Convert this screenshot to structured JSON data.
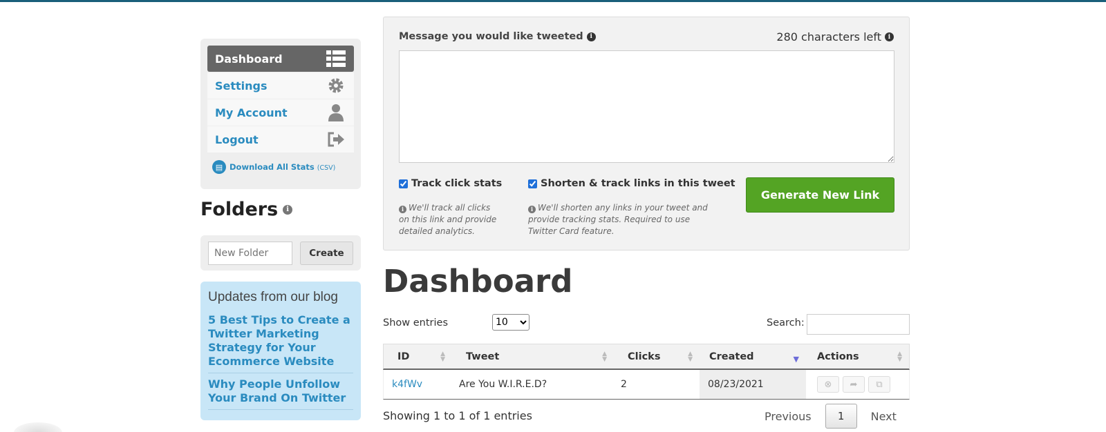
{
  "sidebar": {
    "menu": [
      {
        "label": "Dashboard",
        "icon": "list-icon",
        "active": true
      },
      {
        "label": "Settings",
        "icon": "gear-icon"
      },
      {
        "label": "My Account",
        "icon": "user-icon"
      },
      {
        "label": "Logout",
        "icon": "logout-icon"
      }
    ],
    "download": {
      "label": "Download All Stats",
      "suffix": "(CSV)"
    },
    "folders_title": "Folders",
    "folder_placeholder": "New Folder",
    "create_label": "Create",
    "blog": {
      "title": "Updates from our blog",
      "posts": [
        "5 Best Tips to Create a Twitter Marketing Strategy for Your Ecommerce Website",
        "Why People Unfollow Your Brand On Twitter"
      ]
    }
  },
  "composer": {
    "message_label": "Message you would like tweeted",
    "chars_left": "280 characters left",
    "tweet_value": "",
    "track_clicks": {
      "label": "Track click stats",
      "checked": true,
      "hint": "We'll track all clicks on this link and provide detailed analytics."
    },
    "shorten_links": {
      "label": "Shorten & track links in this tweet",
      "checked": true,
      "hint": "We'll shorten any links in your tweet and provide tracking stats. Required to use Twitter Card feature."
    },
    "generate_label": "Generate New Link"
  },
  "dashboard": {
    "title": "Dashboard",
    "show_entries_label": "Show entries",
    "entries_value": "10",
    "search_label": "Search:",
    "columns": [
      "ID",
      "Tweet",
      "Clicks",
      "Created",
      "Actions"
    ],
    "rows": [
      {
        "id": "k4fWv",
        "tweet": "Are You W.I.R.E.D?",
        "clicks": "2",
        "created": "08/23/2021"
      }
    ],
    "showing": "Showing 1 to 1 of 1 entries",
    "pagination": {
      "previous": "Previous",
      "page": "1",
      "next": "Next"
    }
  },
  "colors": {
    "accent": "#2a8bbf",
    "generate": "#54a424",
    "topbar": "#1a5f7a"
  }
}
